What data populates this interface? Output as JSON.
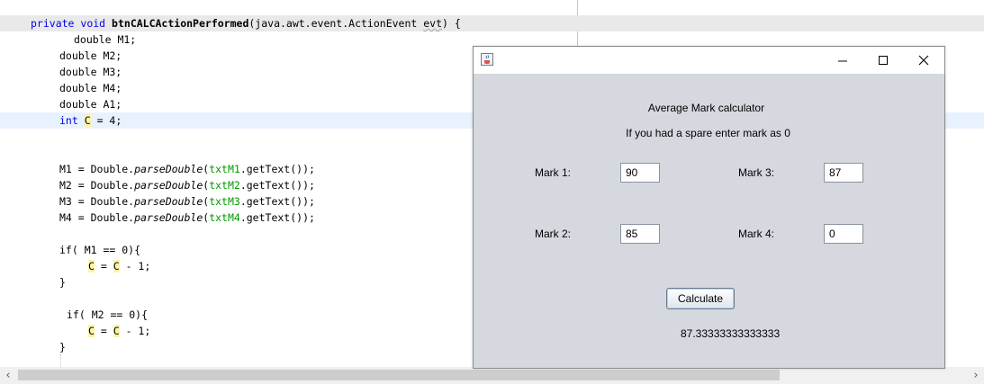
{
  "editor": {
    "lines": [
      {
        "parts": [
          "private",
          " ",
          "void",
          " ",
          "btnCALCActionPerformed",
          "(java.awt.event.ActionEvent ",
          "evt",
          ") {"
        ]
      },
      {
        "text": "double M1;"
      },
      {
        "text": "double M2;"
      },
      {
        "text": "double M3;"
      },
      {
        "text": "double M4;"
      },
      {
        "text": "double A1;"
      },
      {
        "parts": [
          "int",
          " ",
          "C",
          " = 4;"
        ]
      },
      {
        "parts": [
          "M1 = Double.",
          "parseDouble",
          "(",
          "txtM1",
          ".getText());"
        ]
      },
      {
        "parts": [
          "M2 = Double.",
          "parseDouble",
          "(",
          "txtM2",
          ".getText());"
        ]
      },
      {
        "parts": [
          "M3 = Double.",
          "parseDouble",
          "(",
          "txtM3",
          ".getText());"
        ]
      },
      {
        "parts": [
          "M4 = Double.",
          "parseDouble",
          "(",
          "txtM4",
          ".getText());"
        ]
      },
      {
        "text": "if( M1 == 0){"
      },
      {
        "parts": [
          "C",
          " = ",
          "C",
          " - 1;"
        ]
      },
      {
        "text": "}"
      },
      {
        "text": "if( M2 == 0){"
      },
      {
        "parts": [
          "C",
          " = ",
          "C",
          " - 1;"
        ]
      },
      {
        "text": "}"
      }
    ]
  },
  "scrollbar": {
    "left_arrow": "‹",
    "right_arrow": "›",
    "thumb_fraction": 0.8
  },
  "window": {
    "icon": "java-coffee-icon",
    "controls": {
      "minimize": "minimize-icon",
      "maximize": "maximize-icon",
      "close": "close-icon"
    },
    "heading": "Average Mark calculator",
    "subheading": "If you had a spare enter mark as 0",
    "fields": {
      "mark1": {
        "label": "Mark 1:",
        "value": "90"
      },
      "mark2": {
        "label": "Mark 2:",
        "value": "85"
      },
      "mark3": {
        "label": "Mark 3:",
        "value": "87"
      },
      "mark4": {
        "label": "Mark 4:",
        "value": "0"
      }
    },
    "calculate_label": "Calculate",
    "result": "87.33333333333333"
  },
  "colors": {
    "keyword": "#0000e6",
    "field_ref": "#009900",
    "occurrence_highlight": "#fbf3a8",
    "current_line": "#e8f2fe",
    "window_body": "#d5d8df"
  }
}
